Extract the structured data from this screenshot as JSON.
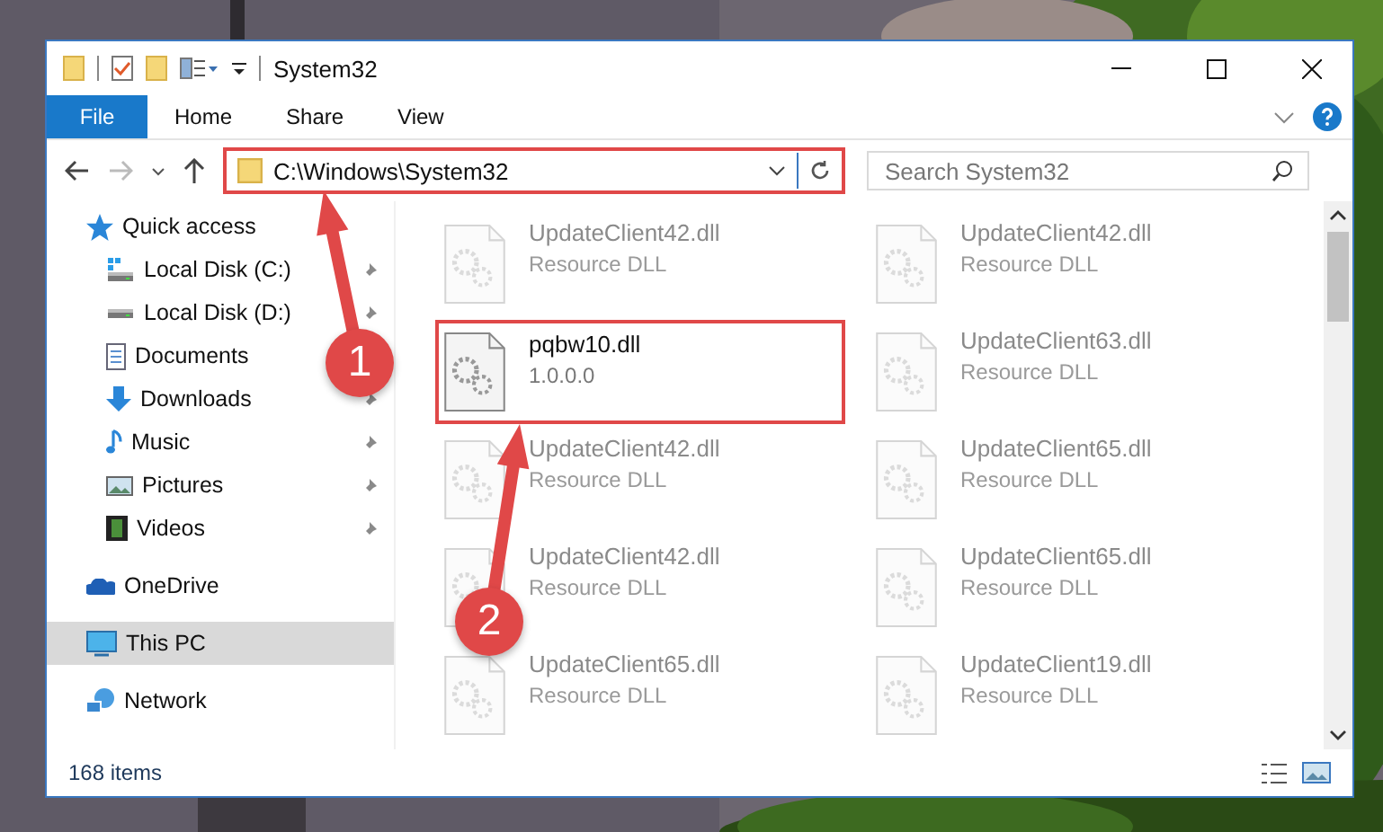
{
  "window": {
    "title": "System32"
  },
  "ribbon": {
    "file_label": "File",
    "tabs": [
      "Home",
      "Share",
      "View"
    ]
  },
  "address_bar": {
    "path": "C:\\Windows\\System32",
    "highlighted": true
  },
  "search": {
    "placeholder": "Search System32"
  },
  "sidebar": {
    "items": [
      {
        "label": "Quick access",
        "kind": "quick",
        "pinned": false,
        "selected": false,
        "children": [
          {
            "label": "Local Disk (C:)",
            "kind": "diskc",
            "pinned": true,
            "selected": false
          },
          {
            "label": "Local Disk (D:)",
            "kind": "disk",
            "pinned": true,
            "selected": false
          },
          {
            "label": "Documents",
            "kind": "docs",
            "pinned": false,
            "selected": false
          },
          {
            "label": "Downloads",
            "kind": "down",
            "pinned": true,
            "selected": false
          },
          {
            "label": "Music",
            "kind": "music",
            "pinned": true,
            "selected": false
          },
          {
            "label": "Pictures",
            "kind": "pics",
            "pinned": true,
            "selected": false
          },
          {
            "label": "Videos",
            "kind": "video",
            "pinned": true,
            "selected": false
          }
        ]
      },
      {
        "label": "OneDrive",
        "kind": "cloud",
        "pinned": false,
        "selected": false
      },
      {
        "label": "This PC",
        "kind": "pc",
        "pinned": false,
        "selected": true
      },
      {
        "label": "Network",
        "kind": "net",
        "pinned": false,
        "selected": false
      }
    ]
  },
  "files": [
    {
      "name": "UpdateClient42.dll",
      "detail": "Resource DLL",
      "blurred": true,
      "highlighted": false
    },
    {
      "name": "UpdateClient42.dll",
      "detail": "Resource DLL",
      "blurred": true,
      "highlighted": false
    },
    {
      "name": "pqbw10.dll",
      "detail": "1.0.0.0",
      "blurred": false,
      "highlighted": true
    },
    {
      "name": "UpdateClient63.dll",
      "detail": "Resource DLL",
      "blurred": true,
      "highlighted": false
    },
    {
      "name": "UpdateClient42.dll",
      "detail": "Resource DLL",
      "blurred": true,
      "highlighted": false
    },
    {
      "name": "UpdateClient65.dll",
      "detail": "Resource DLL",
      "blurred": true,
      "highlighted": false
    },
    {
      "name": "UpdateClient42.dll",
      "detail": "Resource DLL",
      "blurred": true,
      "highlighted": false
    },
    {
      "name": "UpdateClient65.dll",
      "detail": "Resource DLL",
      "blurred": true,
      "highlighted": false
    },
    {
      "name": "UpdateClient65.dll",
      "detail": "Resource DLL",
      "blurred": true,
      "highlighted": false
    },
    {
      "name": "UpdateClient19.dll",
      "detail": "Resource DLL",
      "blurred": true,
      "highlighted": false
    }
  ],
  "status_bar": {
    "count": "168 items"
  },
  "markers": [
    {
      "label": "1"
    },
    {
      "label": "2"
    }
  ]
}
